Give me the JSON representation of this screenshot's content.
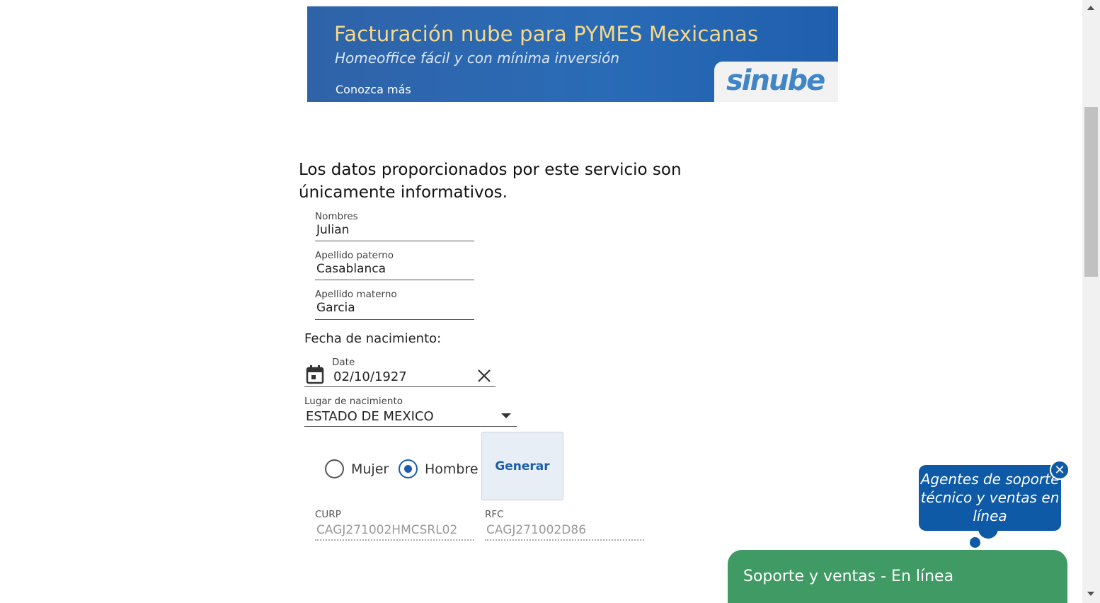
{
  "banner": {
    "title": "Facturación nube para PYMES Mexicanas",
    "subtitle": "Homeoffice fácil y con mínima inversión",
    "cta": "Conozca más",
    "logo_text": "sinube",
    "colors": {
      "background": "#2a6bb6",
      "title": "#f6d98a",
      "logo": "#3f85c8"
    }
  },
  "heading": "Los datos proporcionados por este servicio son únicamente informativos.",
  "form": {
    "nombres": {
      "label": "Nombres",
      "value": "Julian"
    },
    "apellido_paterno": {
      "label": "Apellido paterno",
      "value": "Casablanca"
    },
    "apellido_materno": {
      "label": "Apellido materno",
      "value": "Garcia"
    },
    "fecha_label": "Fecha de nacimiento:",
    "date": {
      "label": "Date",
      "value": "02/10/1927",
      "icon": "calendar-icon",
      "clear_icon": "close-icon"
    },
    "lugar": {
      "label": "Lugar de nacimiento",
      "value": "ESTADO DE MEXICO"
    },
    "sexo": {
      "options": [
        {
          "label": "Mujer",
          "checked": false
        },
        {
          "label": "Hombre",
          "checked": true
        }
      ]
    },
    "generate_label": "Generar",
    "curp": {
      "label": "CURP",
      "value": "CAGJ271002HMCSRL02"
    },
    "rfc": {
      "label": "RFC",
      "value": "CAGJ271002D86"
    }
  },
  "chat": {
    "bubble_text": "Agentes de soporte técnico y ventas en línea",
    "close_symbol": "✕",
    "support_label": "Soporte y ventas - En línea",
    "colors": {
      "bubble": "#0e5aa7",
      "support_bar": "#3f9a63"
    }
  }
}
